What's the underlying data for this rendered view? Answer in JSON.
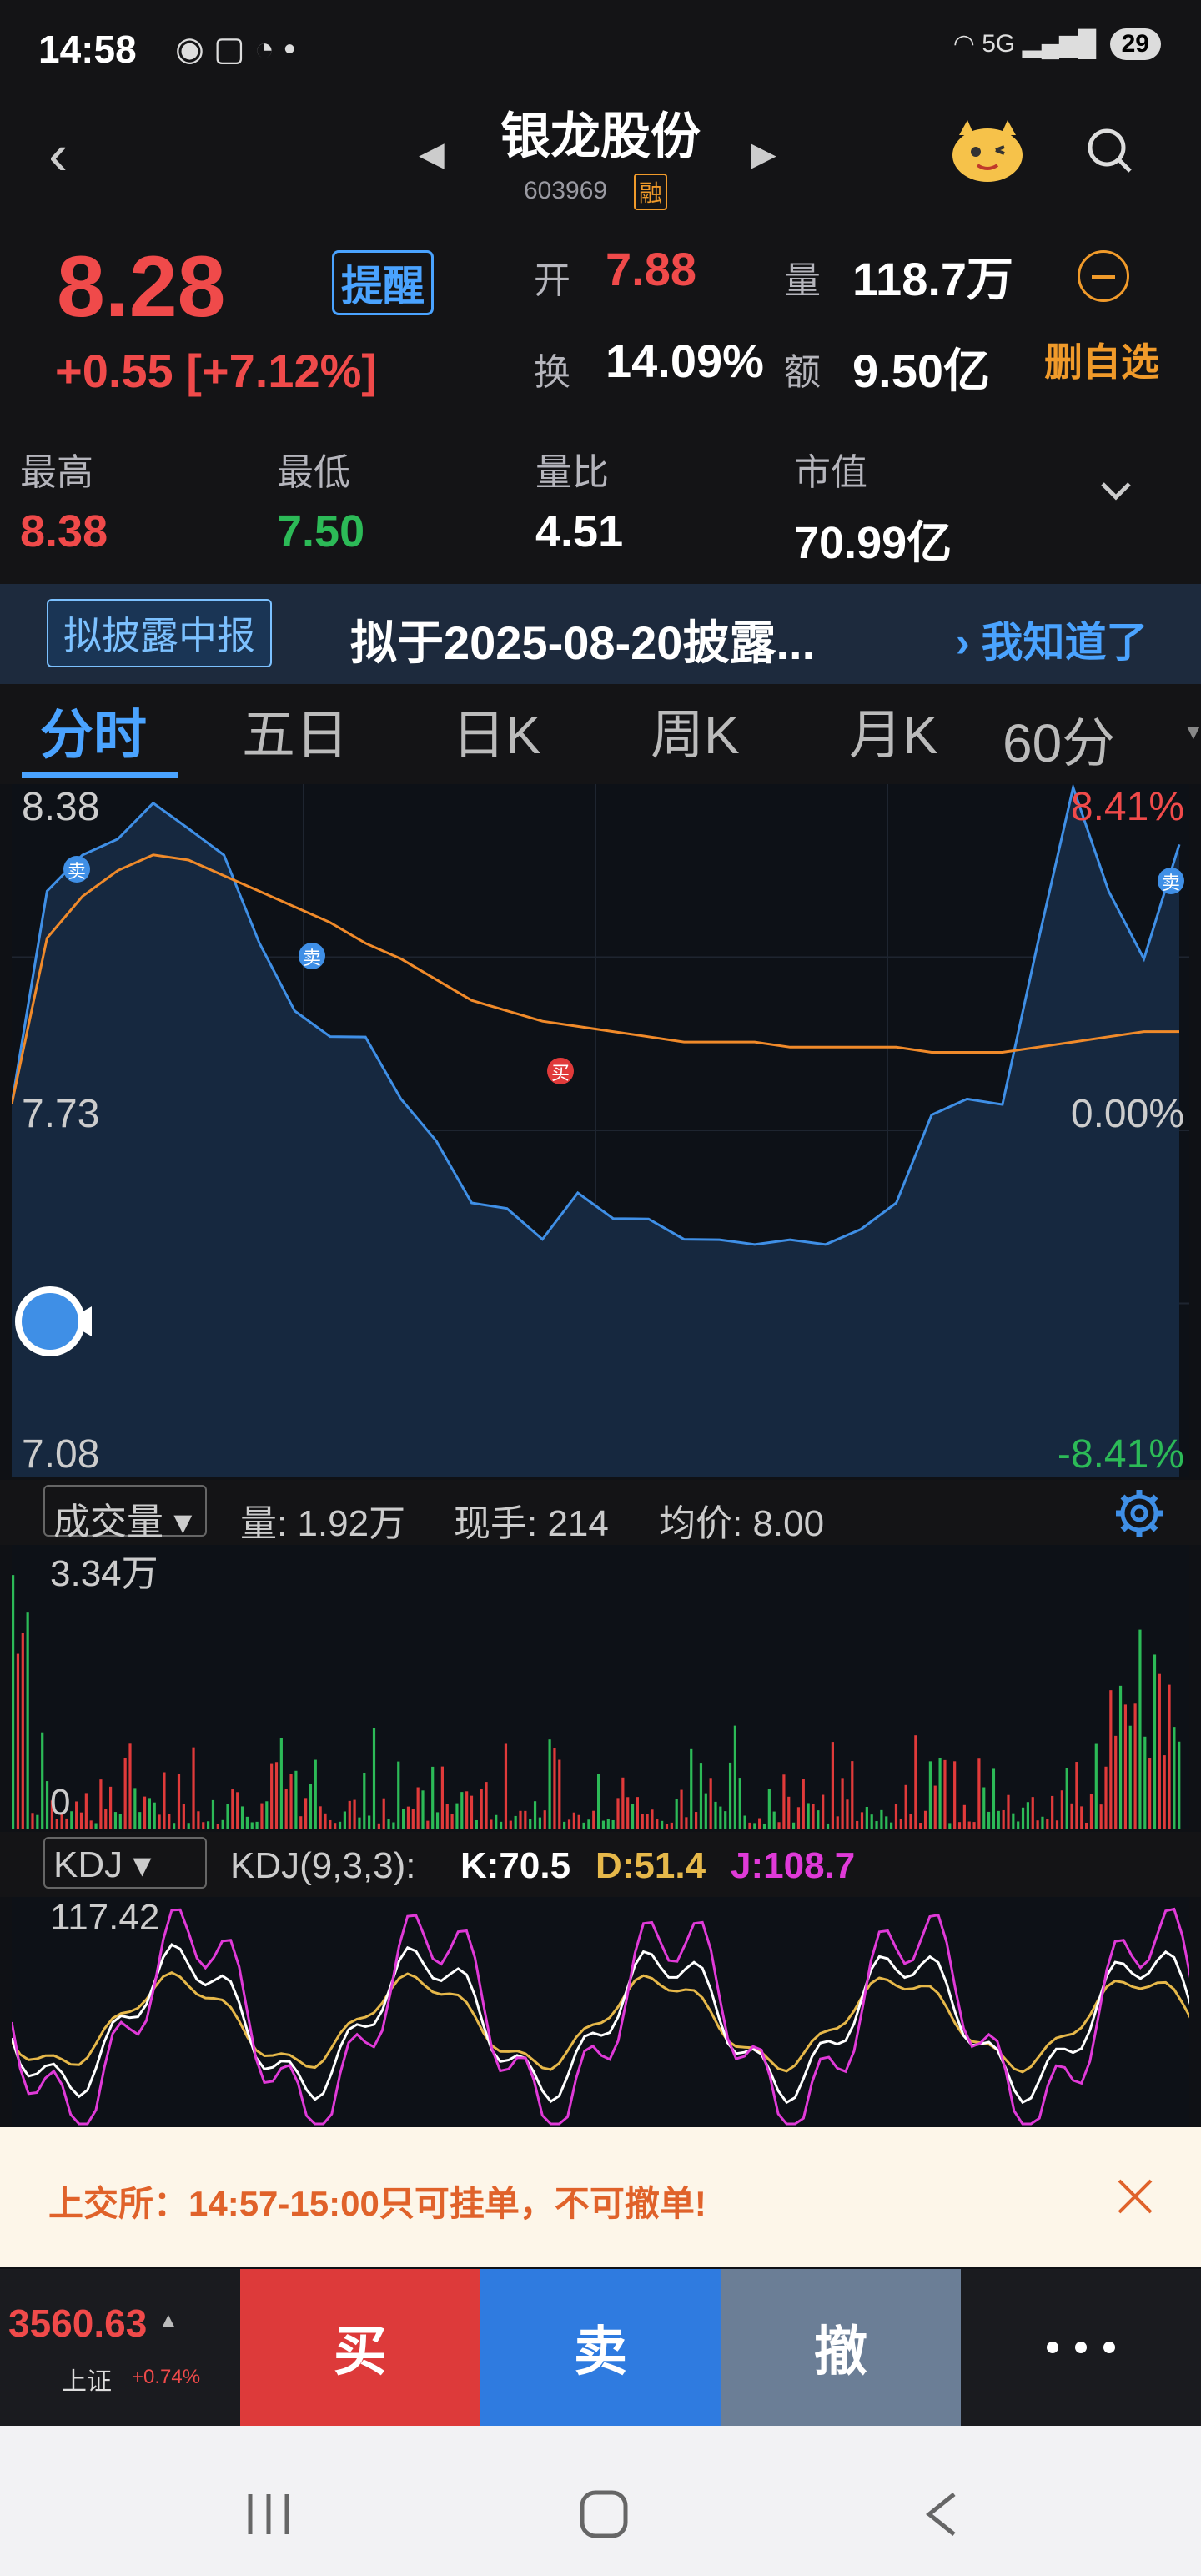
{
  "status": {
    "time": "14:58",
    "net": "5G",
    "battery": "29"
  },
  "header": {
    "title": "银龙股份",
    "code": "603969",
    "margin_badge": "融"
  },
  "quote": {
    "price": "8.28",
    "change": "+0.55 [+7.12%]",
    "remind": "提醒",
    "open_label": "开",
    "open": "7.88",
    "volume_label": "量",
    "volume": "118.7万",
    "turnover_label": "换",
    "turnover": "14.09%",
    "amount_label": "额",
    "amount": "9.50亿",
    "del_fav": "删自选",
    "high_label": "最高",
    "high": "8.38",
    "low_label": "最低",
    "low": "7.50",
    "ratio_label": "量比",
    "ratio": "4.51",
    "mcap_label": "市值",
    "mcap": "70.99亿"
  },
  "notice": {
    "tag": "拟披露中报",
    "text": "拟于2025-08-20披露...",
    "ok": "› 我知道了"
  },
  "tabs": [
    "分时",
    "五日",
    "日K",
    "周K",
    "月K",
    "60分"
  ],
  "chart": {
    "y_top": "8.38",
    "y_mid": "7.73",
    "y_bot": "7.08",
    "pct_top": "8.41%",
    "pct_mid": "0.00%",
    "pct_bot": "-8.41%",
    "sell_mark": "卖",
    "buy_mark": "买"
  },
  "chart_data": {
    "type": "line",
    "series": [
      {
        "values": [
          7.78,
          8.2,
          8.25,
          8.3,
          8.35,
          8.32,
          8.25,
          8.1,
          7.95,
          7.92,
          7.9,
          7.8,
          7.7,
          7.6,
          7.57,
          7.53,
          7.6,
          7.57,
          7.55,
          7.53,
          7.51,
          7.52,
          7.51,
          7.52,
          7.53,
          7.6,
          7.75,
          7.8,
          7.77,
          8.1,
          8.38,
          8.2,
          8.05,
          8.28
        ]
      },
      {
        "values": [
          7.78,
          8.1,
          8.18,
          8.23,
          8.26,
          8.25,
          8.22,
          8.19,
          8.16,
          8.13,
          8.09,
          8.06,
          8.02,
          7.98,
          7.96,
          7.94,
          7.93,
          7.92,
          7.91,
          7.9,
          7.9,
          7.9,
          7.89,
          7.89,
          7.89,
          7.89,
          7.88,
          7.88,
          7.88,
          7.89,
          7.9,
          7.91,
          7.92,
          7.92
        ]
      }
    ],
    "ylim": [
      7.08,
      8.38
    ]
  },
  "volume": {
    "selector": "成交量",
    "vol": "量: 1.92万",
    "hand": "现手: 214",
    "avg": "均价: 8.00",
    "max": "3.34万",
    "zero": "0"
  },
  "kdj": {
    "selector": "KDJ",
    "params": "KDJ(9,3,3):",
    "k": "K:70.5",
    "d": "D:51.4",
    "j": "J:108.7",
    "max": "117.42",
    "k_color": "#ffffff",
    "d_color": "#e6b84a",
    "j_color": "#e03ad8"
  },
  "toast": {
    "text": "上交所：14:57-15:00只可挂单，不可撤单!"
  },
  "trade": {
    "index_value": "3560.63",
    "index_name": "上证",
    "index_change": "+0.74%",
    "buy": "买",
    "sell": "卖",
    "cancel": "撤"
  },
  "colors": {
    "up": "#f04a4a",
    "down": "#2cba57",
    "accent": "#4aa3ff",
    "avg_line": "#f08a2a"
  }
}
